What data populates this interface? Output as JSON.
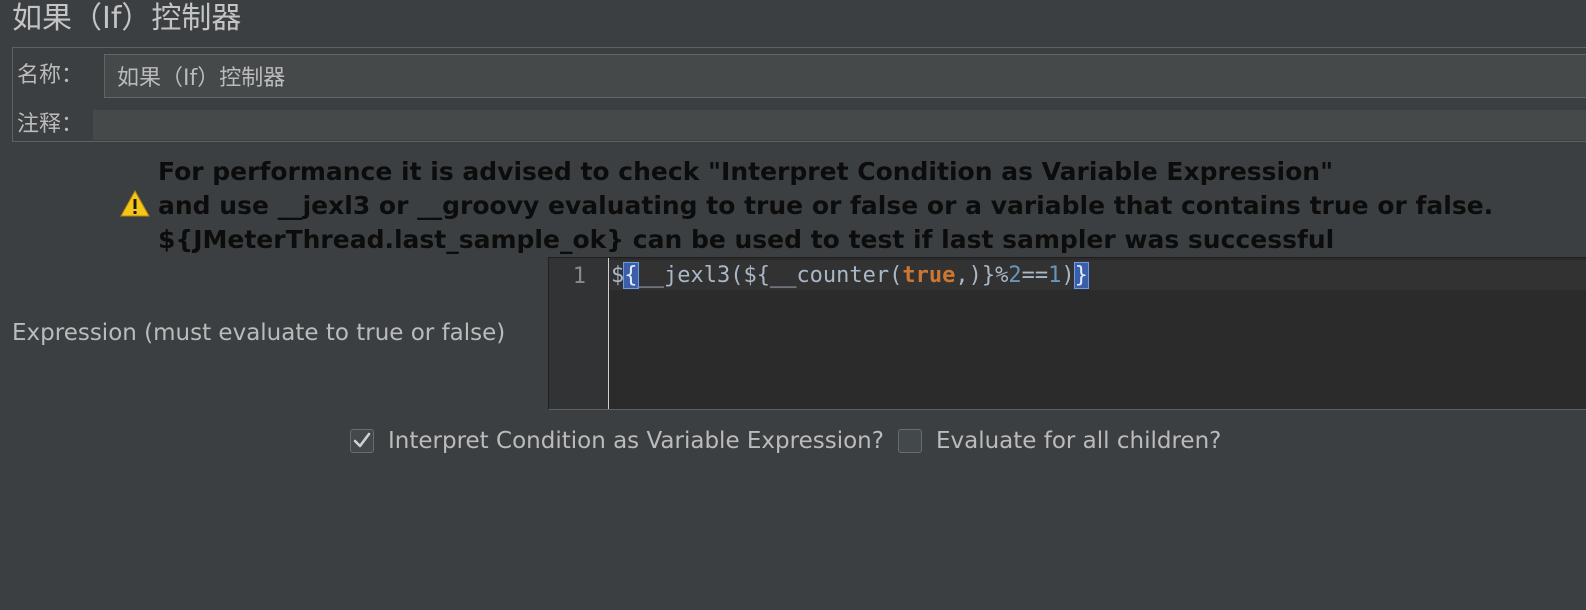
{
  "window": {
    "title": "如果（If）控制器"
  },
  "form": {
    "name_label": "名称：",
    "name_value": "如果（If）控制器",
    "comment_label": "注释：",
    "comment_value": ""
  },
  "warning": {
    "icon": "warning-triangle-icon",
    "lines": [
      "For performance it is advised to check \"Interpret Condition as Variable Expression\"",
      "and use __jexl3 or __groovy evaluating to true or false or a variable that contains true or false.",
      "${JMeterThread.last_sample_ok} can be used to test if last sampler was successful"
    ]
  },
  "expression": {
    "label": "Expression (must evaluate to true or false)",
    "line_number": "1",
    "tokens": {
      "t1": "$",
      "t2": "{",
      "t3": "__jexl3(${__counter(",
      "t4": "true",
      "t5": ",)}%",
      "t6": "2",
      "t7": "==",
      "t8": "1",
      "t9": ")",
      "t10": "}"
    }
  },
  "options": {
    "interpret_label": "Interpret Condition as Variable Expression?",
    "interpret_checked": true,
    "evaluate_all_label": "Evaluate for all children?",
    "evaluate_all_checked": false
  },
  "colors": {
    "background": "#3c3f41",
    "editor_background": "#2b2b2b",
    "keyword": "#cc7832",
    "number": "#6897bb",
    "brace_highlight": "#3b5ea8",
    "warning_yellow": "#f5c518"
  }
}
